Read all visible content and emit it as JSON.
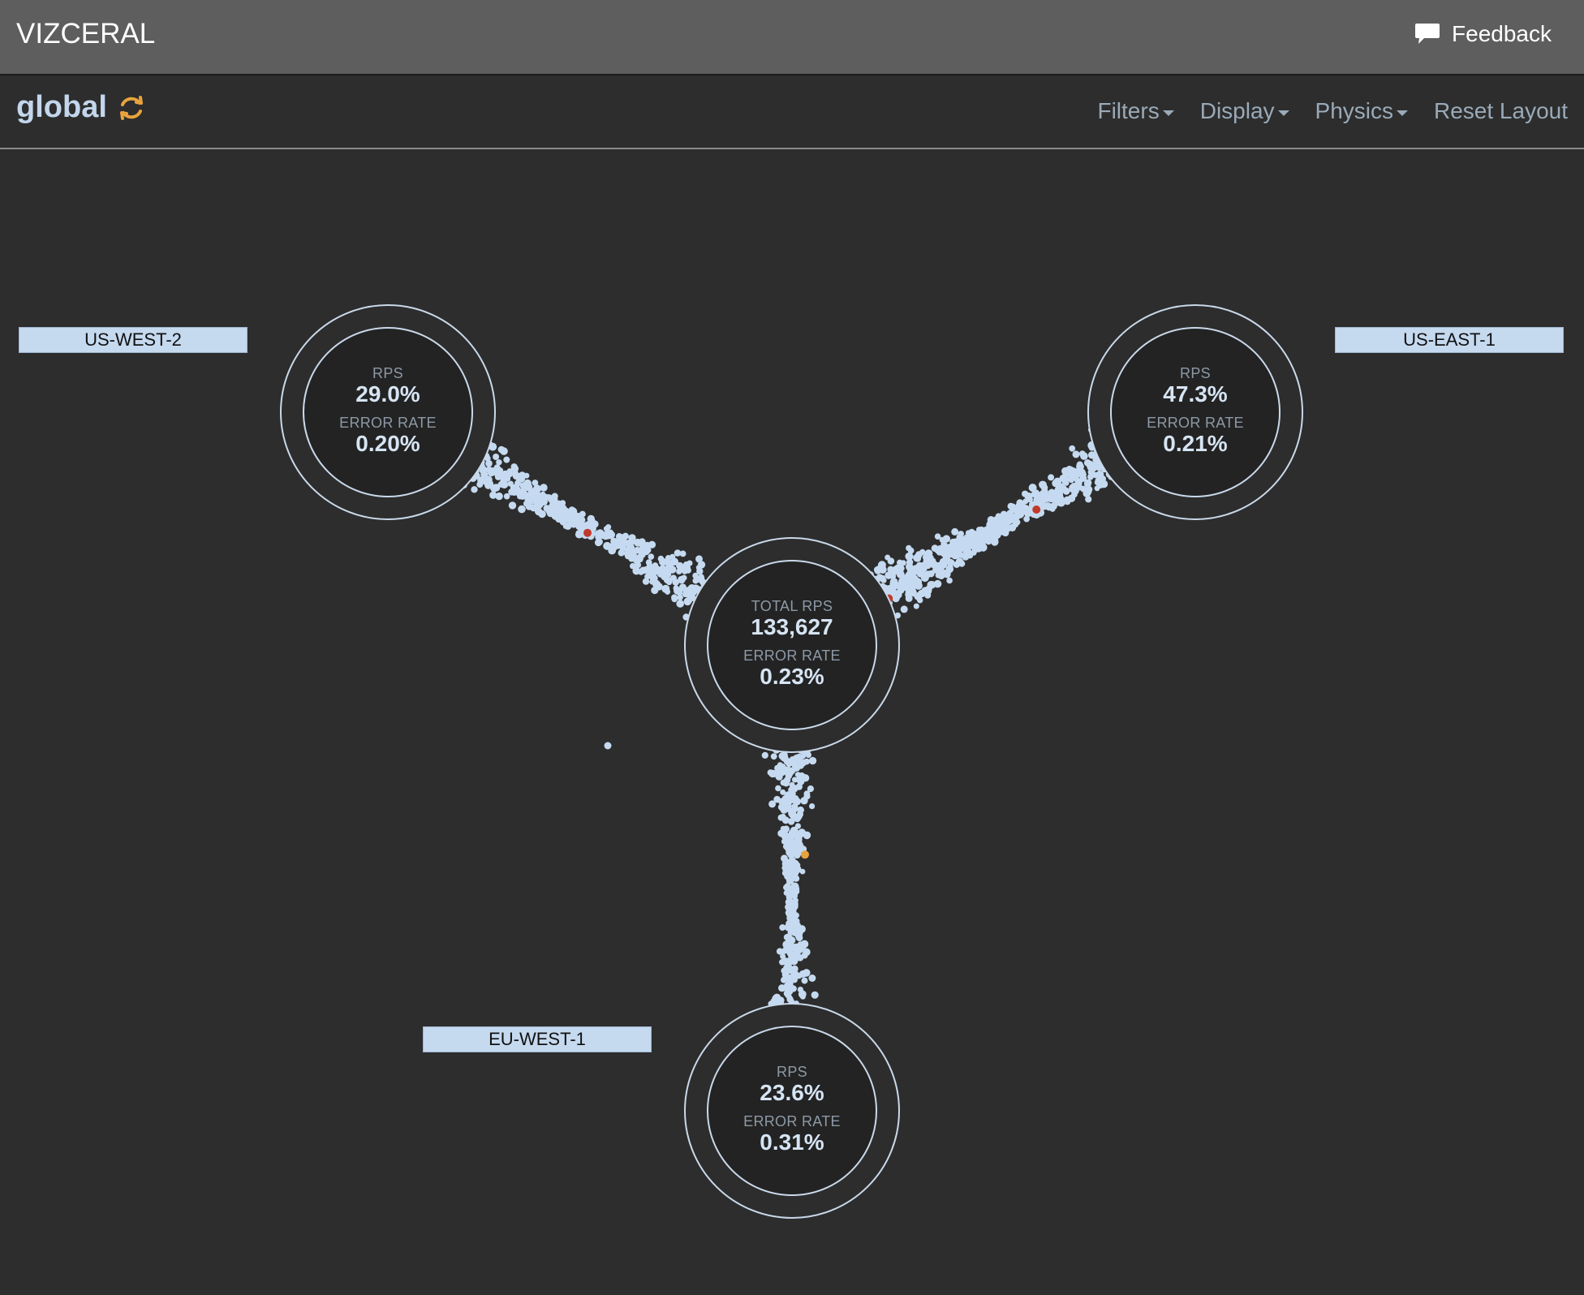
{
  "app": {
    "title": "VIZCERAL"
  },
  "topbar": {
    "feedback_label": "Feedback",
    "feedback_icon": "speech-bubble-icon"
  },
  "subbar": {
    "title": "global",
    "refresh_icon": "refresh-icon",
    "menu": [
      {
        "label": "Filters",
        "dropdown": true
      },
      {
        "label": "Display",
        "dropdown": true
      },
      {
        "label": "Physics",
        "dropdown": true
      },
      {
        "label": "Reset Layout",
        "dropdown": false
      }
    ]
  },
  "regions": {
    "us_west_2": {
      "label": "US-WEST-2",
      "rps_label": "RPS",
      "rps": "29.0%",
      "error_label": "ERROR RATE",
      "error": "0.20%"
    },
    "us_east_1": {
      "label": "US-EAST-1",
      "rps_label": "RPS",
      "rps": "47.3%",
      "error_label": "ERROR RATE",
      "error": "0.21%"
    },
    "eu_west_1": {
      "label": "EU-WEST-1",
      "rps_label": "RPS",
      "rps": "23.6%",
      "error_label": "ERROR RATE",
      "error": "0.31%"
    },
    "internet": {
      "rps_label": "TOTAL RPS",
      "rps": "133,627",
      "error_label": "ERROR RATE",
      "error": "0.23%"
    }
  },
  "colors": {
    "background": "#2d2d2d",
    "node_fill": "#232323",
    "node_stroke": "#c9d9ea",
    "particle": "#c5daf0",
    "particle_error": "#c0392b",
    "particle_warning": "#e8a33d",
    "label_bg": "#c5d9ef",
    "accent": "#e8a33d"
  }
}
